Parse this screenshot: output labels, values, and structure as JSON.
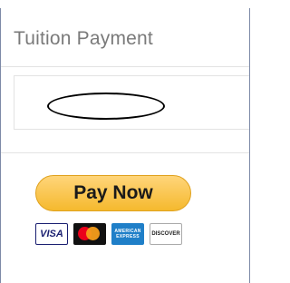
{
  "panel": {
    "title": "Tuition Payment"
  },
  "payment": {
    "button_label": "Pay Now",
    "cards": [
      {
        "name": "visa",
        "label": "VISA"
      },
      {
        "name": "mastercard",
        "label": ""
      },
      {
        "name": "amex",
        "label_line1": "AMERICAN",
        "label_line2": "EXPRESS"
      },
      {
        "name": "discover",
        "label": "DISCOVER"
      }
    ]
  },
  "colors": {
    "button_top": "#ffd57a",
    "button_bottom": "#f5b92e",
    "title_text": "#7a7a7a",
    "panel_border": "#7d8aa7"
  }
}
